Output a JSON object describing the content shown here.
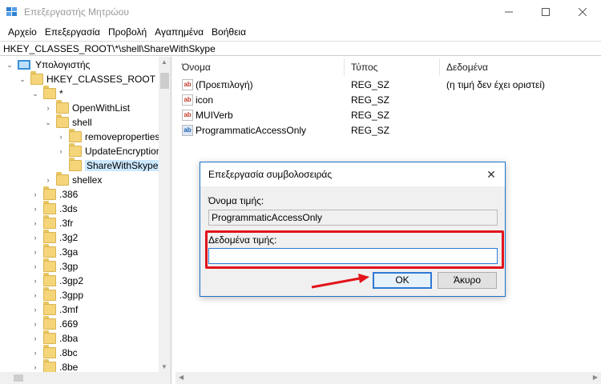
{
  "window": {
    "title": "Επεξεργαστής Μητρώου",
    "controls": {
      "minimize": "—",
      "maximize": "☐",
      "close": "✕"
    }
  },
  "menu": [
    "Αρχείο",
    "Επεξεργασία",
    "Προβολή",
    "Αγαπημένα",
    "Βοήθεια"
  ],
  "address": "HKEY_CLASSES_ROOT\\*\\shell\\ShareWithSkype",
  "tree": {
    "root": "Υπολογιστής",
    "hkcr": "HKEY_CLASSES_ROOT",
    "star": "*",
    "openwithlist": "OpenWithList",
    "shell": "shell",
    "removeproperties": "removeproperties",
    "updateencryption": "UpdateEncryption",
    "sharewithskype": "ShareWithSkype",
    "shellex": "shellex",
    "extensions": [
      ".386",
      ".3ds",
      ".3fr",
      ".3g2",
      ".3ga",
      ".3gp",
      ".3gp2",
      ".3gpp",
      ".3mf",
      ".669",
      ".8ba",
      ".8bc",
      ".8be"
    ]
  },
  "list": {
    "headers": {
      "name": "Όνομα",
      "type": "Τύπος",
      "data": "Δεδομένα"
    },
    "rows": [
      {
        "name": "(Προεπιλογή)",
        "type": "REG_SZ",
        "data": "(η τιμή δεν έχει οριστεί)",
        "icon": "ab"
      },
      {
        "name": "icon",
        "type": "REG_SZ",
        "data": "",
        "icon": "ab"
      },
      {
        "name": "MUIVerb",
        "type": "REG_SZ",
        "data": "",
        "icon": "ab"
      },
      {
        "name": "ProgrammaticAccessOnly",
        "type": "REG_SZ",
        "data": "",
        "icon": "ab"
      }
    ]
  },
  "dialog": {
    "title": "Επεξεργασία συμβολοσειράς",
    "close": "✕",
    "value_name_label": "Όνομα τιμής:",
    "value_name": "ProgrammaticAccessOnly",
    "value_data_label": "Δεδομένα τιμής:",
    "value_data": "",
    "ok": "ΟΚ",
    "cancel": "Άκυρο"
  },
  "colors": {
    "highlight": "#e2141b",
    "accent": "#2d7ad6",
    "selection": "#cce8ff"
  }
}
